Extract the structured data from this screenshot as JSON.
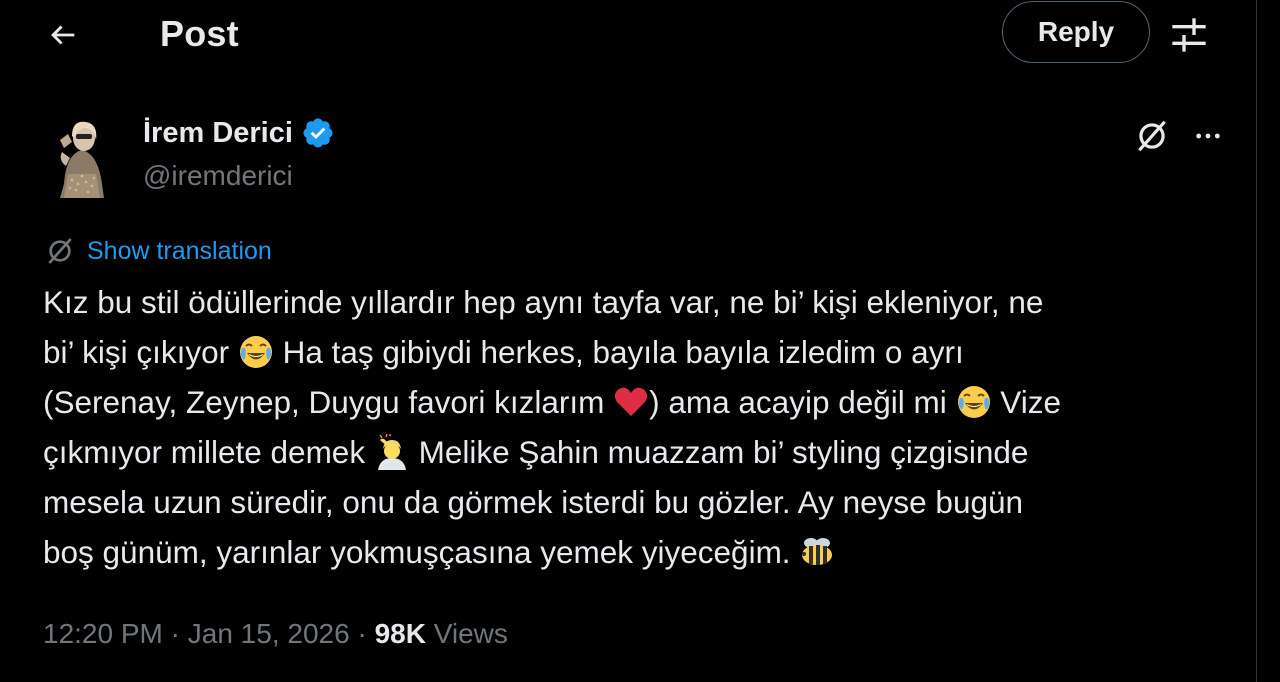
{
  "header": {
    "title": "Post",
    "reply_label": "Reply",
    "back_icon": "arrow-left-icon",
    "filter_icon": "sliders-icon"
  },
  "author": {
    "name": "İrem Derici",
    "handle": "@iremderici",
    "verified": true,
    "verified_color": "#1d9bf0"
  },
  "actions": {
    "grok_icon": "grok-icon",
    "more_icon": "more-horizontal-icon"
  },
  "translation": {
    "label": "Show translation",
    "link_color": "#1d9bf0"
  },
  "tweet": {
    "segments": {
      "s1": "Kız bu stil ödüllerinde yıllardır hep aynı tayfa var, ne bi’ kişi ekleniyor, ne",
      "s2a": "bi’ kişi çıkıyor ",
      "s2b": " Ha taş gibiydi herkes, bayıla bayıla izledim o ayrı",
      "s3a": "(Serenay, Zeynep, Duygu favori kızlarım ",
      "s3b": ") ama acayip değil mi ",
      "s3c": " Vize",
      "s4a": "çıkmıyor millete demek ",
      "s4b": " Melike Şahin muazzam bi’ styling çizgisinde",
      "s5": "mesela uzun süredir, onu da görmek isterdi bu gözler. Ay neyse bugün",
      "s6a": "boş günüm, yarınlar yokmuşçasına yemek yiyeceğim. "
    },
    "emojis": [
      "laughing-tears-emoji",
      "red-heart-emoji",
      "laughing-tears-emoji",
      "person-facepalming-emoji",
      "bee-emoji"
    ]
  },
  "meta": {
    "time": "12:20 PM",
    "separator": " · ",
    "date": "Jan 15, 2026",
    "views_count": "98K",
    "views_label": " Views"
  },
  "colors": {
    "background": "#000000",
    "text": "#e7e9ea",
    "secondary": "#71767b",
    "border": "#536471"
  }
}
